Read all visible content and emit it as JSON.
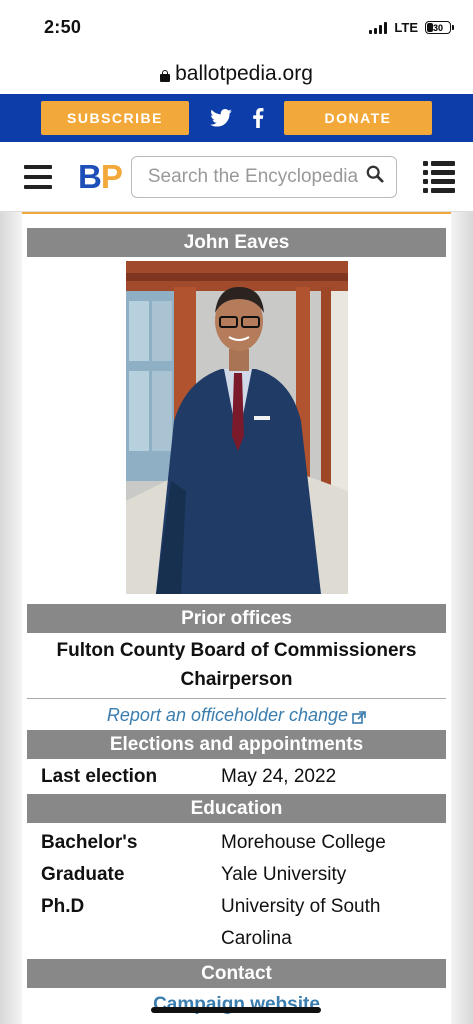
{
  "status": {
    "time": "2:50",
    "network": "LTE",
    "battery": "30",
    "battery_level": 0.3
  },
  "browser": {
    "url": "ballotpedia.org"
  },
  "topbar": {
    "subscribe_label": "SUBSCRIBE",
    "donate_label": "DONATE"
  },
  "nav": {
    "logo_b": "B",
    "logo_p": "P",
    "search_placeholder": "Search the Encyclopedia"
  },
  "infobox": {
    "name": "John Eaves",
    "prior_offices_header": "Prior offices",
    "prior_office": "Fulton County Board of Commissioners Chairperson",
    "report_link": "Report an officeholder change",
    "elections_header": "Elections and appointments",
    "last_election_label": "Last election",
    "last_election_value": "May 24, 2022",
    "education_header": "Education",
    "education": [
      {
        "label": "Bachelor's",
        "value": "Morehouse College"
      },
      {
        "label": "Graduate",
        "value": "Yale University"
      },
      {
        "label": "Ph.D",
        "value": "University of South Carolina"
      }
    ],
    "contact_header": "Contact",
    "campaign_link": "Campaign website"
  },
  "colors": {
    "brand_blue": "#0c3da8",
    "brand_orange": "#f3a83a",
    "link_blue": "#3a7dae",
    "header_gray": "#888888"
  }
}
